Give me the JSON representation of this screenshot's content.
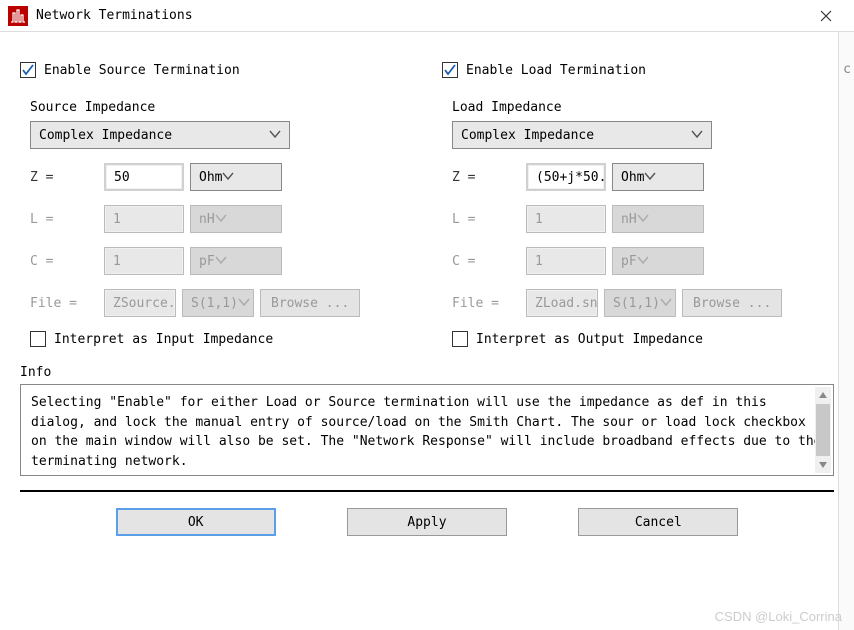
{
  "title": "Network Terminations",
  "source": {
    "enable_label": "Enable Source Termination",
    "enable_checked": true,
    "section_label": "Source Impedance",
    "type_value": "Complex Impedance",
    "z_label": "Z =",
    "z_value": "50",
    "z_unit": "Ohm",
    "l_label": "L =",
    "l_value": "1",
    "l_unit": "nH",
    "c_label": "C =",
    "c_value": "1",
    "c_unit": "pF",
    "file_label": "File =",
    "file_value": "ZSource.",
    "file_param": "S(1,1)",
    "browse_label": "Browse ...",
    "interpret_label": "Interpret as Input Impedance",
    "interpret_checked": false
  },
  "load": {
    "enable_label": "Enable Load Termination",
    "enable_checked": true,
    "section_label": "Load Impedance",
    "type_value": "Complex Impedance",
    "z_label": "Z =",
    "z_value": "(50+j*50.",
    "z_unit": "Ohm",
    "l_label": "L =",
    "l_value": "1",
    "l_unit": "nH",
    "c_label": "C =",
    "c_value": "1",
    "c_unit": "pF",
    "file_label": "File =",
    "file_value": "ZLoad.sn",
    "file_param": "S(1,1)",
    "browse_label": "Browse ...",
    "interpret_label": "Interpret as Output Impedance",
    "interpret_checked": false
  },
  "info": {
    "label": "Info",
    "text": "Selecting \"Enable\" for either Load or Source termination will use the impedance as def in this dialog, and lock the manual entry of source/load on the Smith Chart.  The sour or load lock checkbox on the main window will also be set. The \"Network Response\" will include broadband effects due to the terminating network."
  },
  "buttons": {
    "ok": "OK",
    "apply": "Apply",
    "cancel": "Cancel"
  },
  "watermark": "CSDN @Loki_Corrina",
  "edge_char": "c"
}
